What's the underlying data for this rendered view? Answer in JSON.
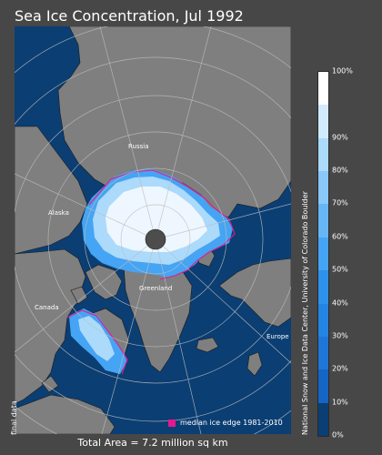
{
  "title": "Sea Ice Concentration, Jul 1992",
  "map": {
    "region_labels": {
      "russia": "Russia",
      "alaska": "Alaska",
      "canada": "Canada",
      "greenland": "Greenland",
      "europe": "Europe"
    }
  },
  "colorbar": {
    "ticks": [
      "0%",
      "10%",
      "20%",
      "30%",
      "40%",
      "50%",
      "60%",
      "70%",
      "80%",
      "90%",
      "100%"
    ],
    "colors": [
      "#0b3e73",
      "#1565c5",
      "#1e77d6",
      "#2484e2",
      "#2e92ec",
      "#45a4f3",
      "#66b6f6",
      "#8ac8f9",
      "#acdafb",
      "#d2eafd",
      "#ffffff"
    ]
  },
  "legend": {
    "label": "median ice edge 1981-2010",
    "color": "#e6188f"
  },
  "total_area": "Total Area = 7.2 million sq km",
  "side_note": "final data",
  "credit": "National Snow and Ice Data Center, University of Colorado Boulder",
  "colors": {
    "ocean": "#0b3e73",
    "land": "#7f7f7f",
    "pole_hole": "#4d4d4d",
    "background": "#474747"
  }
}
